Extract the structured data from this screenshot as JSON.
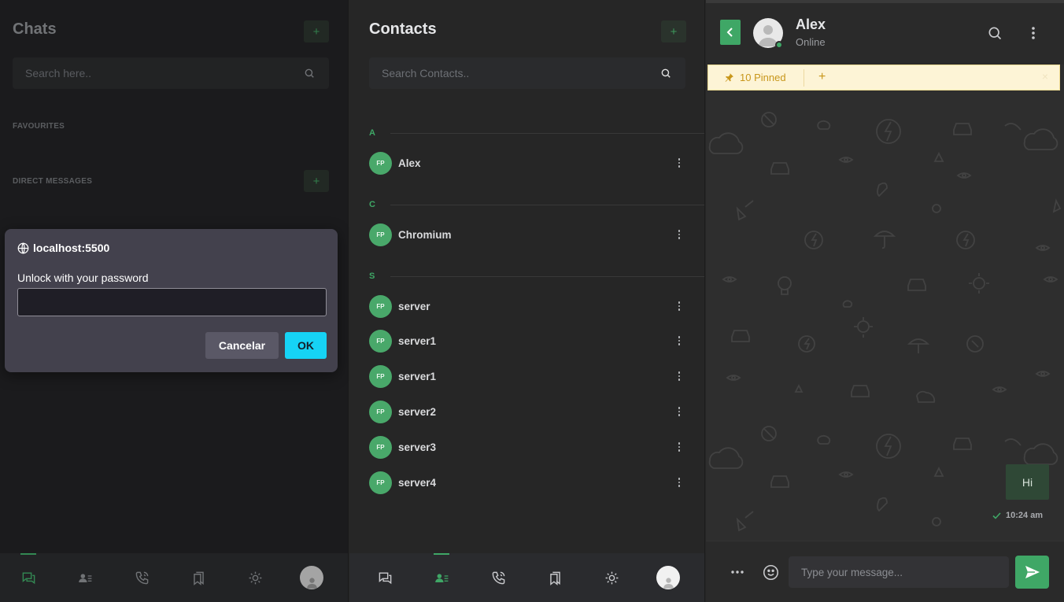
{
  "chats": {
    "title": "Chats",
    "search_placeholder": "Search here..",
    "favourites_label": "FAVOURITES",
    "direct_messages_label": "DIRECT MESSAGES"
  },
  "dialog": {
    "host": "localhost:5500",
    "prompt": "Unlock with your password",
    "cancel_label": "Cancelar",
    "ok_label": "OK"
  },
  "contacts": {
    "title": "Contacts",
    "search_placeholder": "Search Contacts..",
    "groups": [
      {
        "letter": "A",
        "items": [
          {
            "initials": "FP",
            "name": "Alex"
          }
        ]
      },
      {
        "letter": "C",
        "items": [
          {
            "initials": "FP",
            "name": "Chromium"
          }
        ]
      },
      {
        "letter": "S",
        "items": [
          {
            "initials": "FP",
            "name": "server"
          },
          {
            "initials": "FP",
            "name": "server1"
          },
          {
            "initials": "FP",
            "name": "server1"
          },
          {
            "initials": "FP",
            "name": "server2"
          },
          {
            "initials": "FP",
            "name": "server3"
          },
          {
            "initials": "FP",
            "name": "server4"
          }
        ]
      }
    ]
  },
  "nav": {
    "icons": [
      "chat-icon",
      "contacts-icon",
      "phone-call-icon",
      "bookmark-icon",
      "sun-icon",
      "avatar"
    ]
  },
  "chat": {
    "name": "Alex",
    "status": "Online",
    "pinned_label": "10 Pinned",
    "pinned_add": "+",
    "pinned_close": "×",
    "message_text": "Hi",
    "message_time": "10:24 am",
    "input_placeholder": "Type your message..."
  },
  "colors": {
    "accent": "#3fa766",
    "dialog_ok": "#16d3f5",
    "pinned_bg": "#fdf4d6"
  }
}
